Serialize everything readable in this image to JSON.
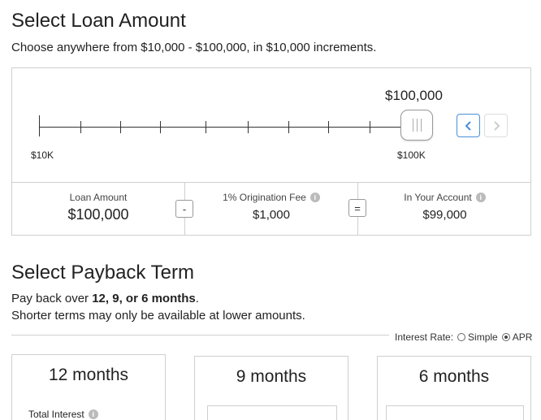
{
  "loan": {
    "title": "Select Loan Amount",
    "subtitle": "Choose anywhere from $10,000 - $100,000, in $10,000 increments.",
    "current_amount": "$100,000",
    "slider": {
      "min_label": "$10K",
      "max_label": "$100K",
      "min": 10000,
      "max": 100000,
      "step": 10000,
      "value": 100000
    },
    "summary": {
      "loan_amount_label": "Loan Amount",
      "loan_amount_value": "$100,000",
      "minus_symbol": "-",
      "fee_label": "1% Origination Fee",
      "fee_value": "$1,000",
      "equals_symbol": "=",
      "account_label": "In Your Account",
      "account_value": "$99,000"
    }
  },
  "payback": {
    "title": "Select Payback Term",
    "line1_prefix": "Pay back over ",
    "line1_bold": "12, 9, or 6 months",
    "line1_suffix": ".",
    "line2": "Shorter terms may only be available at lower amounts.",
    "interest_rate": {
      "label": "Interest Rate:",
      "options": [
        "Simple",
        "APR"
      ],
      "selected": "APR"
    },
    "terms": [
      {
        "label": "12 months",
        "detail_label": "Total Interest"
      },
      {
        "label": "9 months"
      },
      {
        "label": "6 months"
      }
    ]
  },
  "icons": {
    "info": "info-icon",
    "prev": "chevron-left-icon",
    "next": "chevron-right-icon"
  },
  "colors": {
    "accent": "#4a90d9",
    "border": "#cfcfcf"
  }
}
